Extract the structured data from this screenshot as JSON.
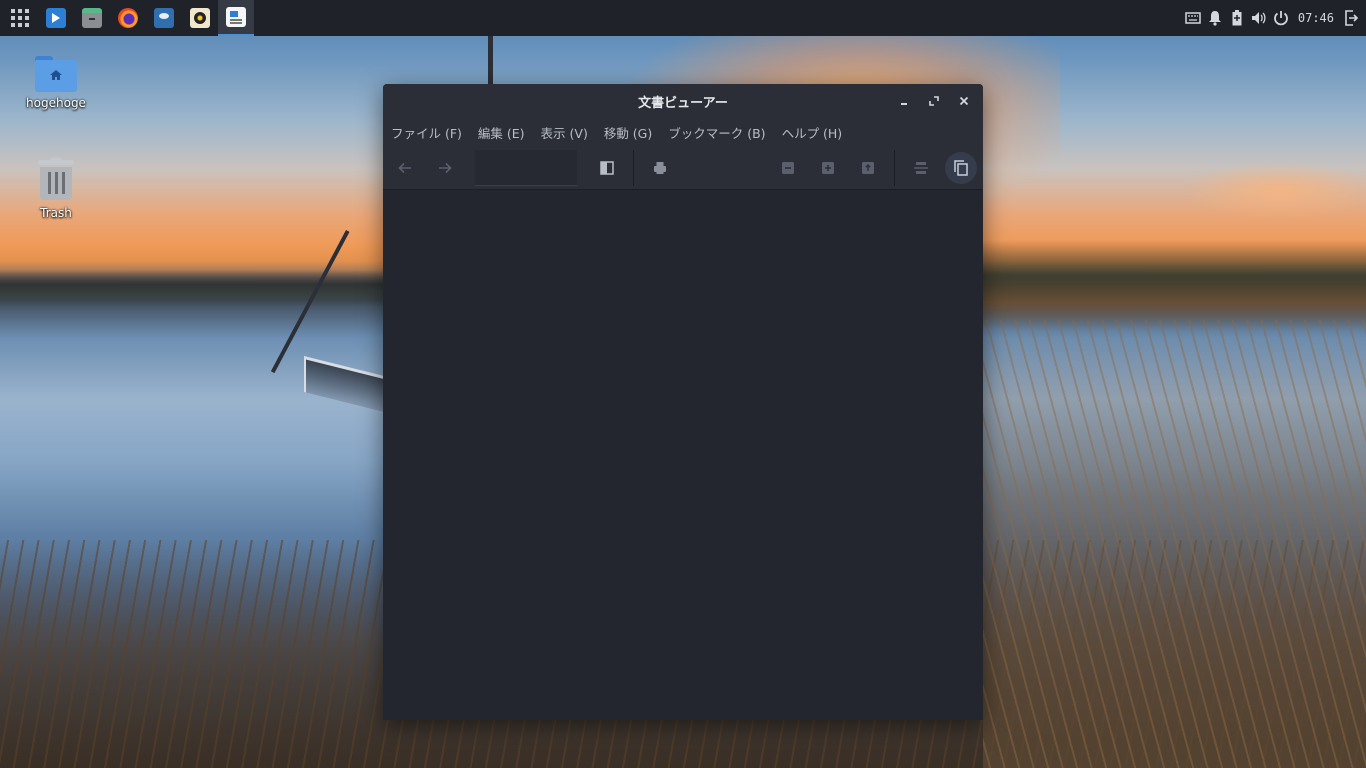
{
  "desktop": {
    "icons": [
      {
        "label": "hogehoge",
        "icon": "home-folder-icon"
      },
      {
        "label": "Trash",
        "icon": "trash-icon"
      }
    ]
  },
  "panel": {
    "apps": [
      {
        "name": "remote-desktop",
        "icon": "remote-desktop-icon",
        "active": false
      },
      {
        "name": "archive-manager",
        "icon": "archive-icon",
        "active": false
      },
      {
        "name": "firefox",
        "icon": "firefox-icon",
        "active": false
      },
      {
        "name": "disk-utility",
        "icon": "disk-icon",
        "active": false
      },
      {
        "name": "rhythmbox",
        "icon": "speaker-icon",
        "active": false
      },
      {
        "name": "document-viewer",
        "icon": "document-viewer-icon",
        "active": true
      }
    ],
    "tray": [
      "keyboard-icon",
      "bell-icon",
      "battery-icon",
      "volume-icon",
      "power-icon"
    ],
    "clock": "07:46",
    "logout_icon": "logout-icon"
  },
  "window": {
    "title": "文書ビューアー",
    "menu": [
      "ファイル (F)",
      "編集 (E)",
      "表示 (V)",
      "移動 (G)",
      "ブックマーク (B)",
      "ヘルプ (H)"
    ],
    "toolbar": {
      "back": "arrow-left-icon",
      "forward": "arrow-right-icon",
      "page_entry": "",
      "sidebar": "sidebar-icon",
      "print": "print-icon",
      "zoom_out": "zoom-out-icon",
      "zoom_in": "zoom-in-icon",
      "zoom_fit": "zoom-fit-icon",
      "continuous": "continuous-icon",
      "dual_page": "dual-page-icon"
    },
    "colors": {
      "accent": "#4a90d9",
      "bg": "#23262e",
      "chrome": "#2b2e37"
    }
  }
}
